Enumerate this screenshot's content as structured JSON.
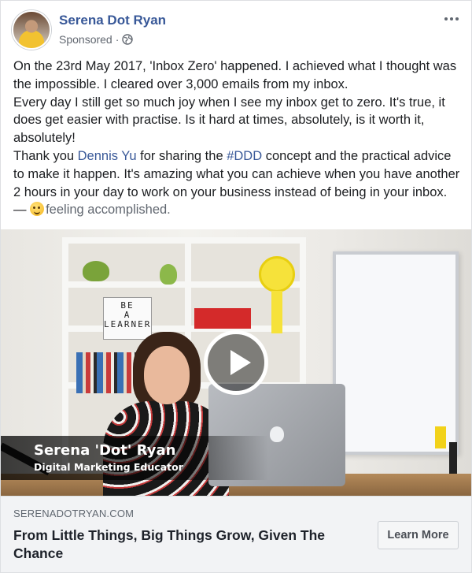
{
  "post": {
    "author_name": "Serena Dot Ryan",
    "sponsored_label": "Sponsored",
    "meta_separator": "·",
    "text": {
      "p1": "On the 23rd May 2017, 'Inbox Zero' happened. I achieved what I thought was the impossible. I cleared over 3,000 emails from my inbox.",
      "p2": "Every day I still get so much joy when I see my inbox get to zero. It's true, it does get easier with practise. Is it hard at times, absolutely, is it worth it, absolutely!",
      "p3_before_mention": "Thank you ",
      "mention": "Dennis Yu",
      "p3_middle": " for sharing the ",
      "hashtag": "#DDD",
      "p3_after_hashtag": " concept and the practical advice to make it happen. It's amazing what you can achieve when you have another 2 hours in your day to work on your business instead of being in your inbox. — ",
      "feeling": "feeling accomplished."
    },
    "icons": {
      "audience": "globe-icon",
      "menu": "more-options-icon",
      "feeling": "smiling-face-icon",
      "play": "play-icon"
    }
  },
  "video": {
    "caption_name": "Serena 'Dot' Ryan",
    "caption_role": "Digital Marketing Educator",
    "letterboard": [
      "BE",
      "A",
      "LEARNER"
    ]
  },
  "link_preview": {
    "domain": "SERENADOTRYAN.COM",
    "headline": "From Little Things, Big Things Grow, Given The Chance",
    "cta_label": "Learn More"
  },
  "colors": {
    "link": "#385898",
    "text": "#1c1e21",
    "meta": "#616770",
    "footer_bg": "#f2f3f5"
  }
}
